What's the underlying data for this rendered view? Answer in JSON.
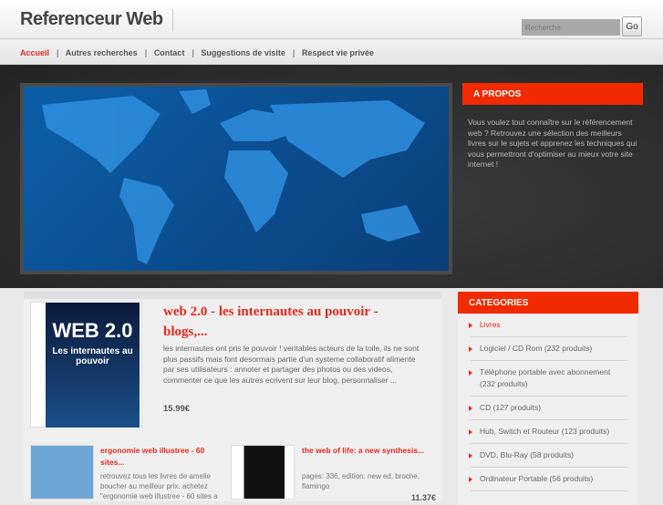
{
  "site": {
    "title": "Referenceur Web",
    "search_placeholder": "Recherche",
    "go_label": "Go"
  },
  "nav": [
    "Accueil",
    "Autres recherches",
    "Contact",
    "Suggestions de visite",
    "Respect vie privée"
  ],
  "apropos": {
    "title": "A PROPOS",
    "text": "Vous voulez tout connaître sur le référencement web ? Retrouvez une sélection des meilleurs livres sur le sujets et apprenez les techniques qui vous permettront d'optimiser au mieux votre site internet !"
  },
  "featured": {
    "title": "web 2.0 - les internautes au pouvoir - blogs,...",
    "cover": "WEB 2.0",
    "cover_sub": "Les internautes au pouvoir",
    "description": "les internautes ont pris le pouvoir ! veritables acteurs de la toile, ils ne sont plus passifs mais font desormais partie d'un systeme collaboratif alimente par ses utilisateurs : annoter et partager des photos ou des videos, commenter ce que les autres ecrivent sur leur blog, personnaliser ...",
    "price": "15.99€"
  },
  "products": [
    {
      "title": "ergonomie web illustree - 60 sites...",
      "description": "retrouvez tous les livres de amelie boucher au meilleur prix. achetez \"ergonomie web illustree - 60 sites a"
    },
    {
      "title": "the web of life: a new synthesis...",
      "description": "pages: 336, edition: new ed, broche, flamingo",
      "price": "11.37€"
    }
  ],
  "categories": {
    "title": "CATEGORIES",
    "items": [
      "Livres",
      "Logiciel / CD Rom (232 produits)",
      "Téléphone portable avec abonnement (232 produits)",
      "CD (127 produits)",
      "Hub, Switch et Routeur (123 produits)",
      "DVD, Blu-Ray (58 produits)",
      "Ordinateur Portable (56 produits)"
    ]
  }
}
